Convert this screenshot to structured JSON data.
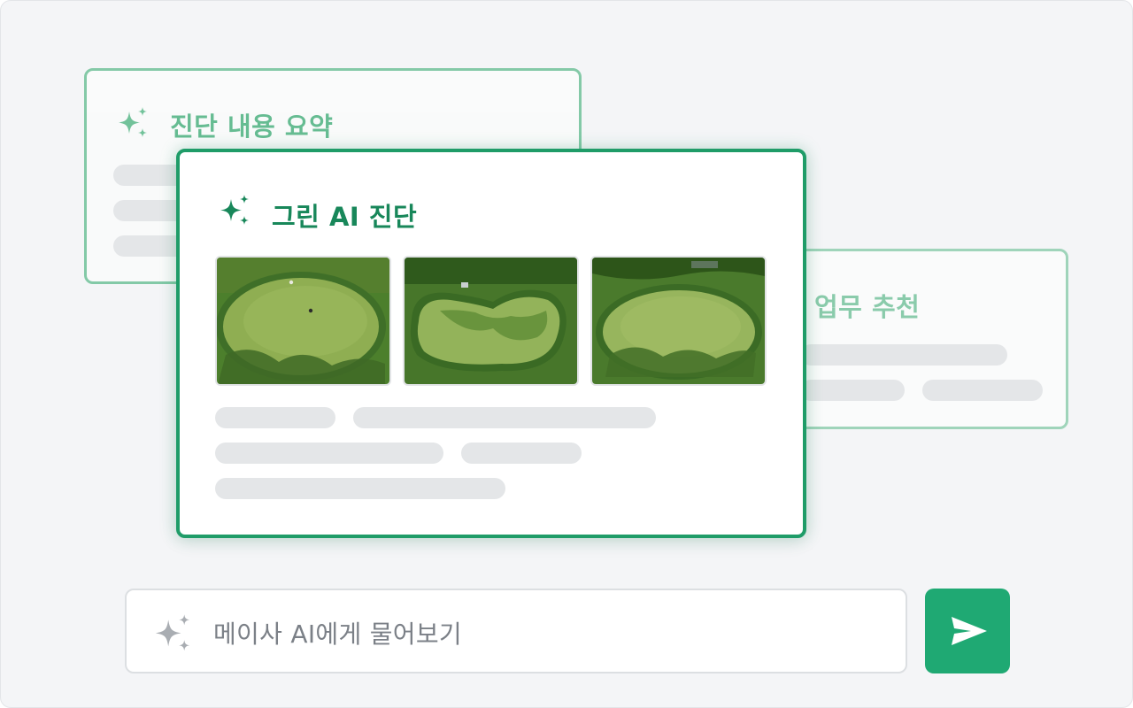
{
  "cards": {
    "summary": {
      "title": "진단 내용 요약"
    },
    "recommend": {
      "title": "업무 추천"
    },
    "main": {
      "title": "그린 AI 진단",
      "photos": [
        "golf-green-aerial-1",
        "golf-green-aerial-2",
        "golf-green-aerial-3"
      ]
    }
  },
  "ask": {
    "placeholder": "메이사 AI에게 물어보기"
  },
  "icons": {
    "sparkle": "sparkle-icon",
    "send": "send-icon"
  },
  "colors": {
    "accent": "#1f9c68",
    "send_button": "#1fa973",
    "background": "#f4f5f7",
    "placeholder_bar": "#e4e6e8"
  }
}
